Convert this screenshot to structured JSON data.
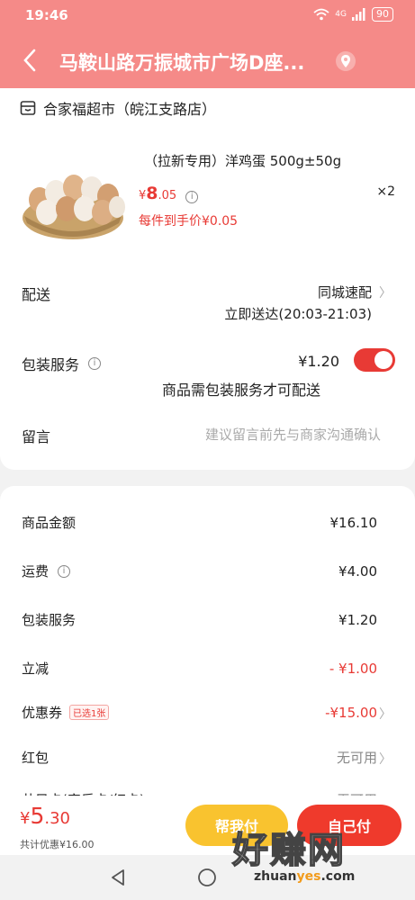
{
  "status": {
    "time": "19:46",
    "network": "4G",
    "battery": "90"
  },
  "header": {
    "title": "马鞍山路万振城市广场D座..."
  },
  "store": {
    "name": "合家福超市（皖江支路店）"
  },
  "product": {
    "title": "（拉新专用）洋鸡蛋 500g±50g",
    "price_symbol": "¥",
    "price_int": "8",
    "price_dec": ".05",
    "qty": "×2",
    "per_price": "每件到手价¥0.05"
  },
  "delivery": {
    "label": "配送",
    "value": "同城速配",
    "time": "立即送达(20:03-21:03)"
  },
  "packaging": {
    "label": "包装服务",
    "price": "¥1.20",
    "note": "商品需包装服务才可配送",
    "enabled": true
  },
  "note": {
    "label": "留言",
    "placeholder": "建议留言前先与商家沟通确认"
  },
  "summary": {
    "goods_label": "商品金额",
    "goods_value": "¥16.10",
    "shipping_label": "运费",
    "shipping_value": "¥4.00",
    "pack_label": "包装服务",
    "pack_value": "¥1.20",
    "discount_label": "立减",
    "discount_value": "- ¥1.00",
    "coupon_label": "优惠券",
    "coupon_tag": "已选1张",
    "coupon_value": "-¥15.00",
    "redpacket_label": "红包",
    "redpacket_value": "无可用",
    "partial_label": "共目卡(家乐卡/红卡)",
    "partial_value": "无可用"
  },
  "footer": {
    "total_symbol": "¥",
    "total_int": "5",
    "total_dec": ".30",
    "discount_text": "共计优惠¥16.00",
    "help_label": "帮我付",
    "pay_label": "自己付"
  },
  "watermark": {
    "big": "好赚网",
    "small_a": "zhuan",
    "small_b": "yes",
    "small_c": ".com"
  },
  "colors": {
    "header": "#f58a88",
    "accent": "#e83a35",
    "help": "#f9c32f",
    "pay": "#ef3a2c"
  }
}
